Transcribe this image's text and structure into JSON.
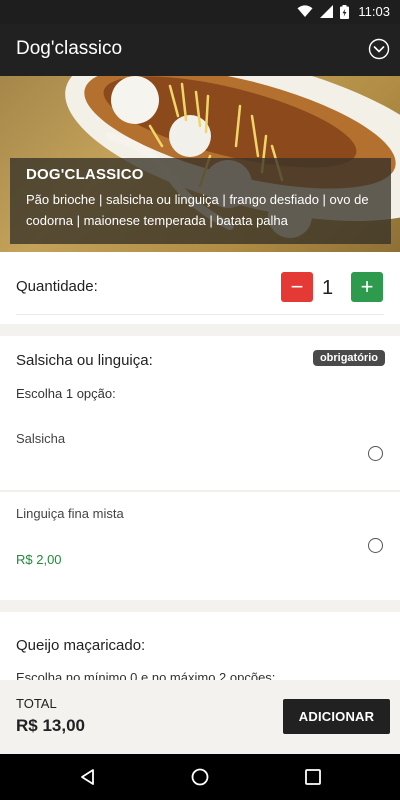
{
  "status_bar": {
    "time": "11:03"
  },
  "app_bar": {
    "title": "Dog'classico"
  },
  "hero": {
    "name": "DOG'CLASSICO",
    "description": "Pão brioche | salsicha ou linguiça | frango desfiado | ovo de codorna | maionese temperada | batata palha"
  },
  "quantity": {
    "label": "Quantidade:",
    "minus": "−",
    "value": "1",
    "plus": "+"
  },
  "groups": [
    {
      "title": "Salsicha ou linguiça:",
      "badge": "obrigatório",
      "hint": "Escolha 1 opção:",
      "options": [
        {
          "name": "Salsicha",
          "price": ""
        },
        {
          "name": "Linguiça fina mista",
          "price": "R$ 2,00"
        }
      ]
    },
    {
      "title": "Queijo maçaricado:",
      "hint": "Escolha no mínimo 0 e no máximo 2 opções:"
    }
  ],
  "footer": {
    "total_label": "TOTAL",
    "total_value": "R$ 13,00",
    "add_label": "ADICIONAR"
  },
  "icons": {
    "status": [
      "wifi-icon",
      "signal-icon",
      "battery-icon"
    ],
    "app_bar": "chevron-down-circle-icon",
    "nav": [
      "back-icon",
      "home-icon",
      "recents-icon"
    ]
  },
  "colors": {
    "app_bar": "#212121",
    "minus": "#e53935",
    "plus": "#2e9a4e",
    "price": "#1e8c3a",
    "badge": "#4a4a4a",
    "add_button": "#212121"
  }
}
